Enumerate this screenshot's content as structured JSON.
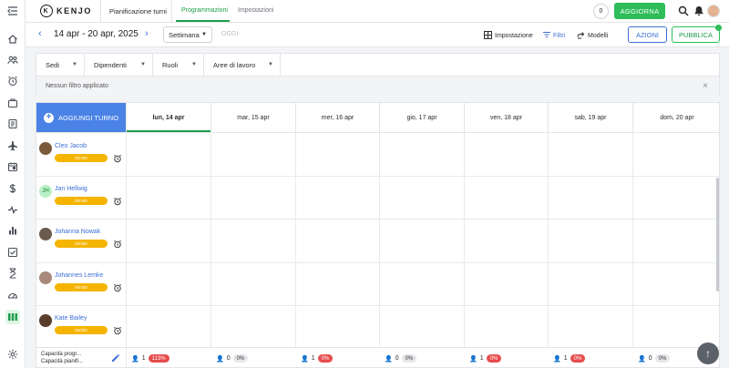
{
  "app": {
    "logo_text": "KENJO",
    "logo_mark": "K"
  },
  "topbar": {
    "title": "Pianificazione turni",
    "tabs": [
      {
        "label": "Programmazioni",
        "active": true
      },
      {
        "label": "Impostazioni",
        "active": false
      }
    ],
    "counter": "0",
    "update_label": "AGGIORNA",
    "accent": "#2ebd59"
  },
  "toolbar": {
    "date_range": "14 apr - 20 apr, 2025",
    "view": "Settimana",
    "today": "OGGI",
    "settings": "Impostazione",
    "filters": "Filtri",
    "templates": "Modelli",
    "actions": "AZIONI",
    "publish": "PUBBLICA"
  },
  "filters": {
    "dropdowns": [
      "Sedi",
      "Dipendenti",
      "Ruoli",
      "Aree di lavoro"
    ],
    "status": "Nessun filtro applicato",
    "close": "×"
  },
  "grid": {
    "add_shift": "AGGIUNGI TURNO",
    "days": [
      {
        "label": "lun, 14 apr",
        "today": true
      },
      {
        "label": "mar, 15 apr"
      },
      {
        "label": "mer, 16 apr"
      },
      {
        "label": "gio, 17 apr"
      },
      {
        "label": "ven, 18 apr"
      },
      {
        "label": "sab, 19 apr"
      },
      {
        "label": "dom, 20 apr"
      }
    ],
    "employees": [
      {
        "name": "Cleo Jacob",
        "hours": "0h/40h",
        "initials": "",
        "avatar_color": "#7a5a3a"
      },
      {
        "name": "Jan Hellwig",
        "hours": "0h/40h",
        "initials": "JH",
        "avatar_color": "#b9f0c6"
      },
      {
        "name": "Johanna Nowak",
        "hours": "0h/30h",
        "initials": "",
        "avatar_color": "#6b5b4f"
      },
      {
        "name": "Johannes Lemke",
        "hours": "0h/40h",
        "initials": "",
        "avatar_color": "#a8897a"
      },
      {
        "name": "Kate Bailey",
        "hours": "0h/30h",
        "initials": "",
        "avatar_color": "#5a3d2b"
      }
    ],
    "footer": {
      "capacity_line_1": "Capacità progr...",
      "capacity_line_2": "Capacità pianifi...",
      "cells": [
        {
          "count": "1",
          "pct": "113%",
          "status": "red"
        },
        {
          "count": "0",
          "pct": "0%",
          "status": "gray"
        },
        {
          "count": "1",
          "pct": "0%",
          "status": "red"
        },
        {
          "count": "0",
          "pct": "0%",
          "status": "gray"
        },
        {
          "count": "1",
          "pct": "0%",
          "status": "red"
        },
        {
          "count": "1",
          "pct": "0%",
          "status": "red"
        },
        {
          "count": "0",
          "pct": "0%",
          "status": "gray"
        }
      ]
    }
  },
  "rail_icons": [
    "collapse-menu-icon",
    "home-icon",
    "people-icon",
    "alarm-clock-icon",
    "briefcase-icon",
    "document-icon",
    "airplane-icon",
    "calendar-icon",
    "dollar-icon",
    "activity-icon",
    "bar-chart-icon",
    "checklist-icon",
    "hourglass-icon",
    "gauge-icon",
    "shift-planner-icon",
    "settings-icon"
  ]
}
